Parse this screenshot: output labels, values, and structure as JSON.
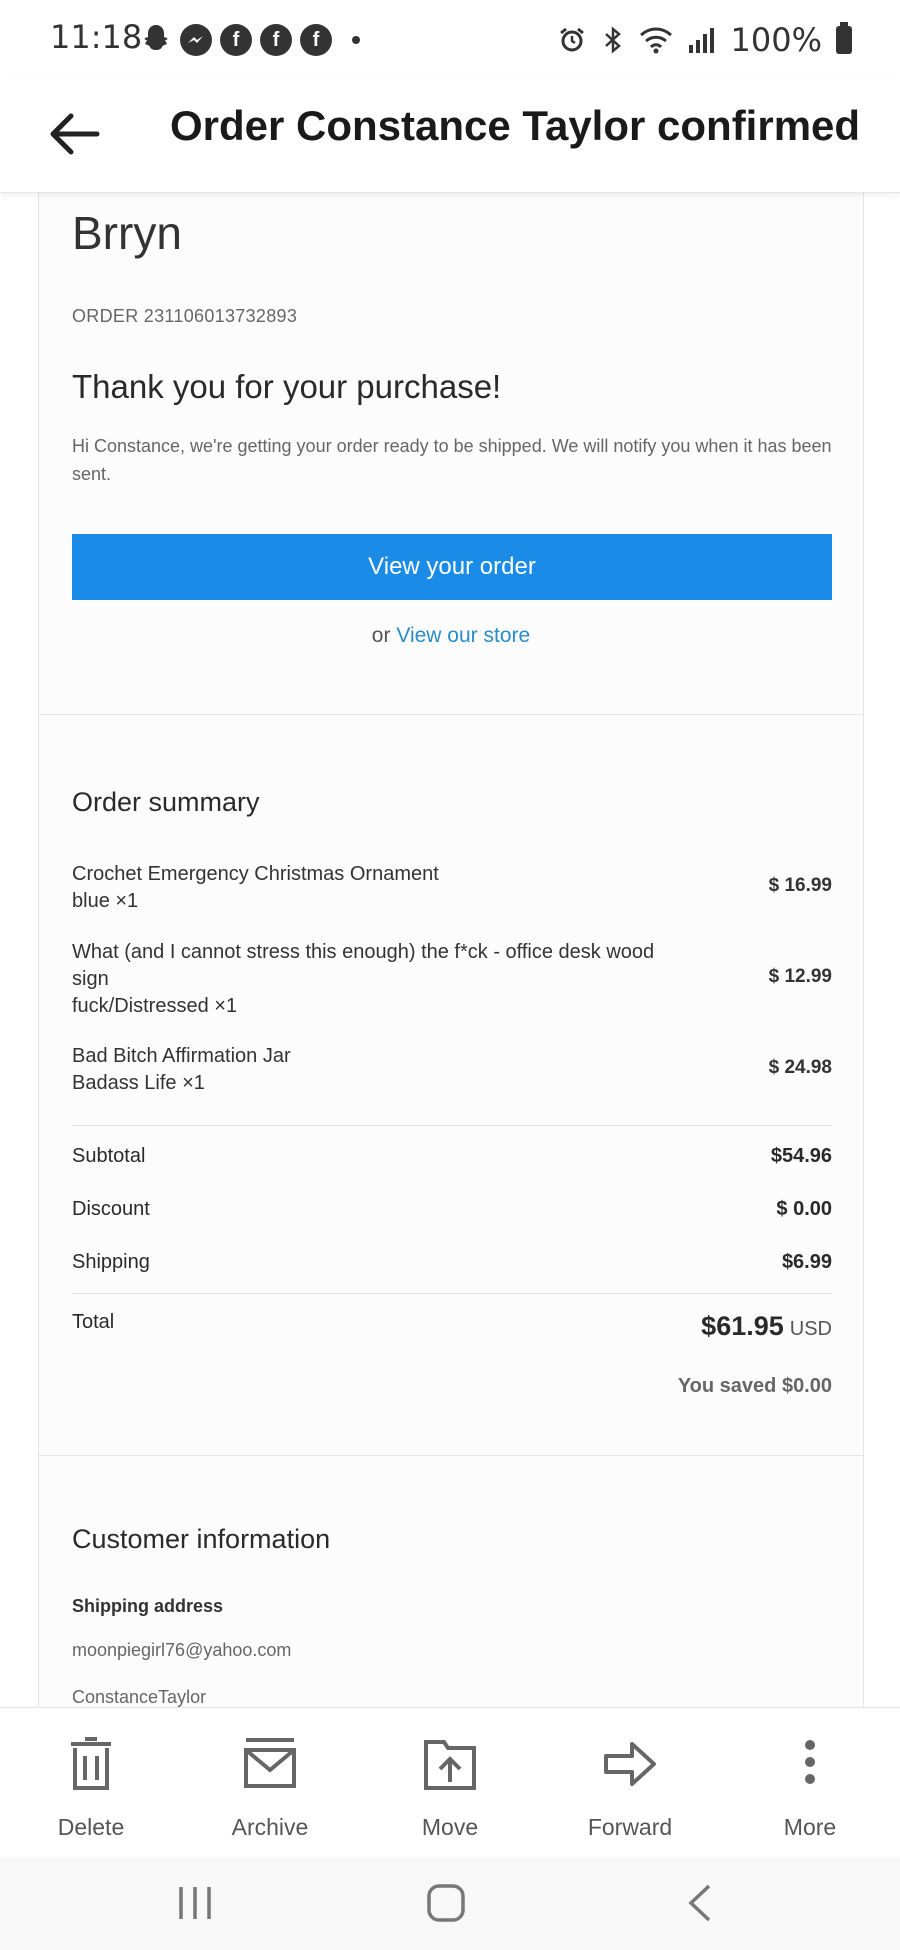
{
  "status_bar": {
    "time": "11:18",
    "battery": "100%",
    "notification_icons": [
      "snapchat-icon",
      "messenger-icon",
      "facebook-icon",
      "facebook-icon",
      "facebook-icon"
    ],
    "system_icons": [
      "alarm-icon",
      "bluetooth-icon",
      "wifi-icon",
      "signal-icon",
      "battery-icon"
    ]
  },
  "header": {
    "title": "Order Constance Taylor confirmed"
  },
  "email": {
    "store_name": "Brryn",
    "order_number": "ORDER 231106013732893",
    "thank_you": "Thank you for your purchase!",
    "intro": "Hi Constance, we're getting your order ready to be shipped. We will notify you when it has been sent.",
    "view_order_button": "View your order",
    "store_prefix": "or",
    "store_link": "View our store",
    "accent_color": "#1a8be6",
    "order_summary": {
      "title": "Order summary",
      "items": [
        {
          "name": "Crochet Emergency Christmas Ornament",
          "variant": "blue ×1",
          "price": "$ 16.99"
        },
        {
          "name": "What (and I cannot stress this enough) the f*ck - office desk wood sign",
          "variant": "fuck/Distressed ×1",
          "price": "$ 12.99"
        },
        {
          "name": "Bad Bitch Affirmation Jar",
          "variant": "Badass Life ×1",
          "price": "$ 24.98"
        }
      ],
      "subtotal_label": "Subtotal",
      "subtotal": "$54.96",
      "discount_label": "Discount",
      "discount": "$ 0.00",
      "shipping_label": "Shipping",
      "shipping": "$6.99",
      "total_label": "Total",
      "total": "$61.95",
      "currency": "USD",
      "saved": "You saved $0.00"
    },
    "customer_info": {
      "title": "Customer information",
      "shipping_address_label": "Shipping address",
      "email": "moonpiegirl76@yahoo.com",
      "name": "ConstanceTaylor"
    }
  },
  "toolbar": {
    "delete": "Delete",
    "archive": "Archive",
    "move": "Move",
    "forward": "Forward",
    "more": "More"
  }
}
